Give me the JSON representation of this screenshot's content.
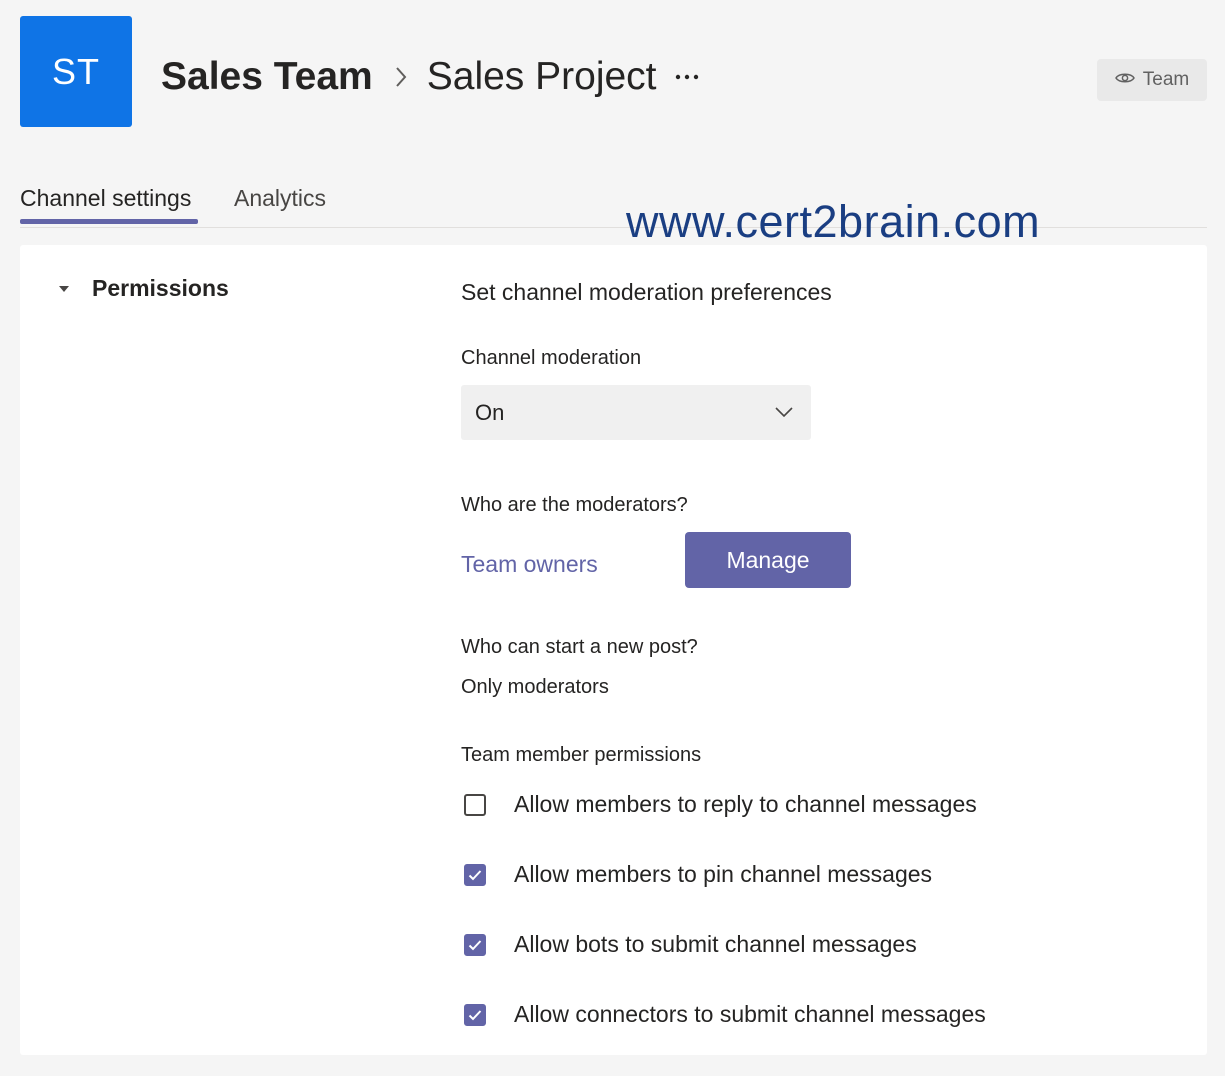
{
  "header": {
    "avatar_initials": "ST",
    "team_name": "Sales Team",
    "channel_name": "Sales Project",
    "more_label": "···",
    "team_badge_label": "Team"
  },
  "tabs": [
    {
      "label": "Channel settings",
      "active": true
    },
    {
      "label": "Analytics",
      "active": false
    }
  ],
  "watermark": "www.cert2brain.com",
  "permissions": {
    "section_title": "Permissions",
    "description": "Set channel moderation preferences",
    "moderation_label": "Channel moderation",
    "moderation_value": "On",
    "moderators_label": "Who are the moderators?",
    "moderators_value": "Team owners",
    "manage_button_label": "Manage",
    "post_label": "Who can start a new post?",
    "post_value": "Only moderators",
    "member_permissions_label": "Team member permissions",
    "checkboxes": [
      {
        "label": "Allow members to reply to channel messages",
        "checked": false
      },
      {
        "label": "Allow members to pin channel messages",
        "checked": true
      },
      {
        "label": "Allow bots to submit channel messages",
        "checked": true
      },
      {
        "label": "Allow connectors to submit channel messages",
        "checked": true
      }
    ]
  },
  "colors": {
    "accent": "#6264a7",
    "avatar_bg": "#0f74e6",
    "watermark": "#1a3e82",
    "page_bg": "#f5f5f5",
    "card_bg": "#ffffff"
  },
  "icons": [
    "chevron-right-icon",
    "more-options-icon",
    "eye-icon",
    "caret-down-icon",
    "chevron-down-icon",
    "checkmark-icon"
  ]
}
